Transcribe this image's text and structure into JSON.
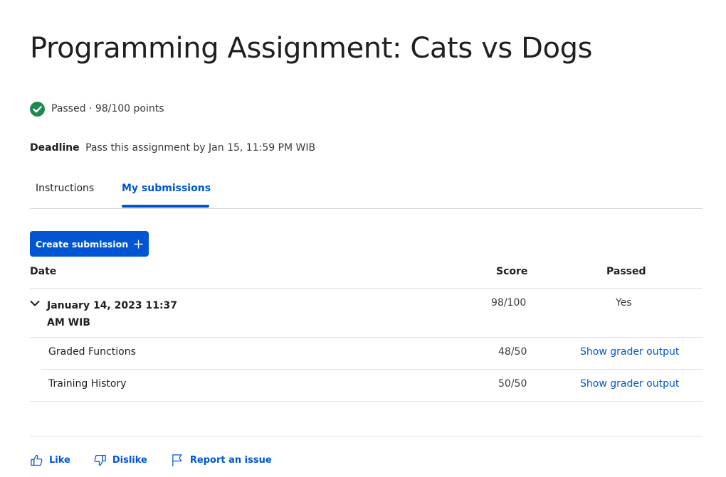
{
  "page": {
    "title": "Programming Assignment: Cats vs Dogs"
  },
  "status": {
    "text": "Passed · 98/100 points",
    "icon": "check-circle-icon",
    "color": "#1e8a52"
  },
  "deadline": {
    "label": "Deadline",
    "text": "Pass this assignment by Jan 15, 11:59 PM WIB"
  },
  "tabs": [
    {
      "label": "Instructions",
      "active": false
    },
    {
      "label": "My submissions",
      "active": true
    }
  ],
  "create_button": {
    "label": "Create submission",
    "icon": "plus-icon"
  },
  "table": {
    "headers": {
      "date": "Date",
      "score": "Score",
      "passed": "Passed"
    },
    "submission": {
      "date": "January 14, 2023 11:37 AM WIB",
      "score": "98/100",
      "passed": "Yes"
    },
    "parts": [
      {
        "name": "Graded Functions",
        "score": "48/50",
        "link": "Show grader output"
      },
      {
        "name": "Training History",
        "score": "50/50",
        "link": "Show grader output"
      }
    ]
  },
  "feedback": {
    "like": "Like",
    "dislike": "Dislike",
    "report": "Report an issue"
  },
  "colors": {
    "accent": "#0056d2",
    "success": "#1e8a52"
  }
}
